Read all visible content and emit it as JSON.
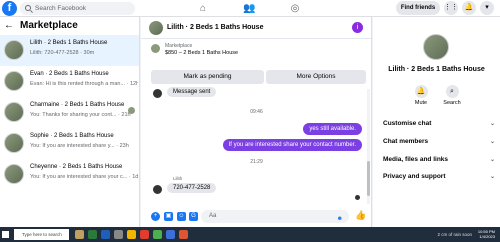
{
  "topbar": {
    "logo": "f",
    "search_placeholder": "Search Facebook",
    "find_friends": "Find friends",
    "nav_icons": [
      "home-icon",
      "friends-icon",
      "groups-icon"
    ],
    "right_icons": [
      "menu-grid-icon",
      "bell-icon",
      "account-chevron-icon"
    ]
  },
  "left": {
    "title": "Marketplace",
    "conversations": [
      {
        "title": "Lilith · 2 Beds 1 Baths House",
        "preview": "Lilith: 720-477-2528 · 30m"
      },
      {
        "title": "Evan · 2 Beds 1 Baths House",
        "preview": "Evan: Hi is this rented through a man... · 12h"
      },
      {
        "title": "Charmaine · 2 Beds 1 Baths House",
        "preview": "You: Thanks for sharing your cont... · 21h"
      },
      {
        "title": "Sophie · 2 Beds 1 Baths House",
        "preview": "You: If you are interested share y... · 23h"
      },
      {
        "title": "Cheyenne · 2 Beds 1 Baths House",
        "preview": "You: If you are interested share your c... · 1d"
      }
    ]
  },
  "chat": {
    "title": "Lilith · 2 Beds 1 Baths House",
    "listing_source": "Marketplace",
    "listing_price": "$850 – 2 Beds 1 Baths House",
    "mark_pending": "Mark as pending",
    "more_options": "More Options",
    "messages": {
      "sent_partial": "Message sent",
      "time1": "09:46",
      "out1": "yes still available.",
      "out2": "If you are interested share your contact number.",
      "time2": "21:29",
      "sender": "Lilith",
      "in1": "720-477-2528"
    },
    "compose_placeholder": "Aa"
  },
  "right": {
    "name": "Lilith · 2 Beds 1 Baths House",
    "mute": "Mute",
    "search": "Search",
    "items": [
      "Customise chat",
      "Chat members",
      "Media, files and links",
      "Privacy and support"
    ]
  },
  "taskbar": {
    "search_placeholder": "Type here to search",
    "tray_text": "2 cm of rain soon",
    "time": "10:55 PM",
    "date": "1/4/2023"
  },
  "colors": {
    "brand": "#1877f2",
    "accent": "#7b3fe4"
  }
}
